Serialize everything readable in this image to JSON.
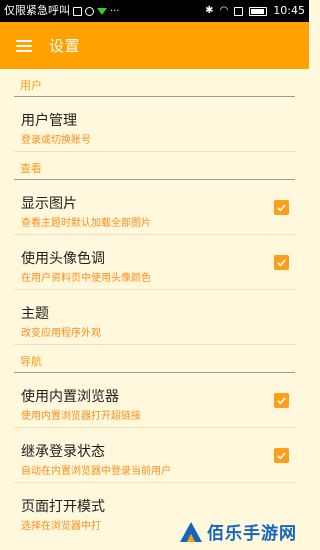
{
  "status_bar": {
    "carrier": "仅限紧急呼叫",
    "time": "10:45"
  },
  "app_bar": {
    "title": "设置"
  },
  "sections": [
    {
      "header": "用户",
      "items": [
        {
          "title": "用户管理",
          "subtitle": "登录或切换账号",
          "checkbox": null
        }
      ]
    },
    {
      "header": "查看",
      "items": [
        {
          "title": "显示图片",
          "subtitle": "查看主题时默认加载全部图片",
          "checkbox": true
        },
        {
          "title": "使用头像色调",
          "subtitle": "在用户资料页中使用头像颜色",
          "checkbox": true
        },
        {
          "title": "主题",
          "subtitle": "改变应用程序外观",
          "checkbox": null
        }
      ]
    },
    {
      "header": "导航",
      "items": [
        {
          "title": "使用内置浏览器",
          "subtitle": "使用内置浏览器打开超链接",
          "checkbox": true
        },
        {
          "title": "继承登录状态",
          "subtitle": "自动在内置浏览器中登录当前用户",
          "checkbox": true
        },
        {
          "title": "页面打开模式",
          "subtitle": "选择在浏览器中打",
          "checkbox": null
        }
      ]
    }
  ],
  "watermark": {
    "text": "佰乐手游网"
  },
  "colors": {
    "accent": "#ffa200",
    "background": "#fff8dc",
    "subtitle": "#ff8c1a",
    "watermark": "#1565c0"
  }
}
